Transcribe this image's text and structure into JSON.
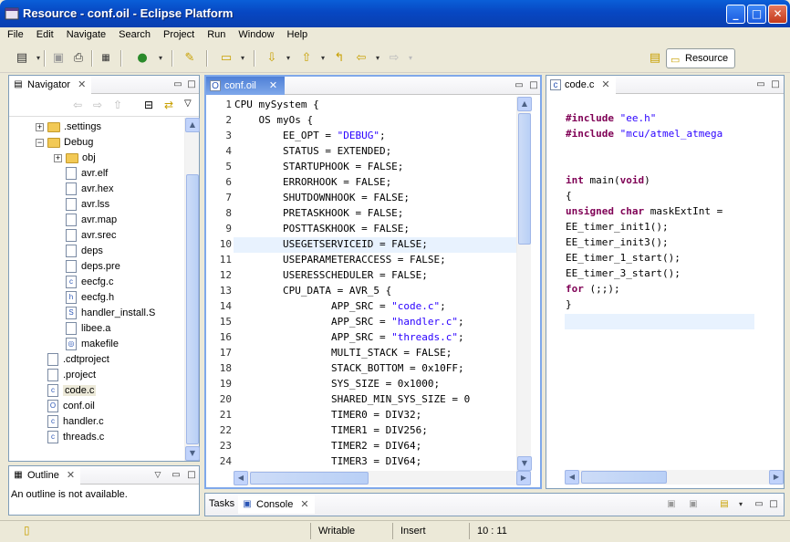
{
  "window": {
    "title": "Resource - conf.oil - Eclipse Platform",
    "min": "_",
    "max": "□",
    "close": "✕"
  },
  "menu": [
    "File",
    "Edit",
    "Navigate",
    "Search",
    "Project",
    "Run",
    "Window",
    "Help"
  ],
  "perspective": {
    "label": "Resource"
  },
  "navigator": {
    "title": "Navigator",
    "tree": [
      {
        "label": ".settings",
        "type": "folder",
        "depth": 1,
        "expander": "+"
      },
      {
        "label": "Debug",
        "type": "folder",
        "depth": 1,
        "expander": "−"
      },
      {
        "label": "obj",
        "type": "folder",
        "depth": 2,
        "expander": "+"
      },
      {
        "label": "avr.elf",
        "type": "file",
        "depth": 2
      },
      {
        "label": "avr.hex",
        "type": "file",
        "depth": 2
      },
      {
        "label": "avr.lss",
        "type": "file",
        "depth": 2
      },
      {
        "label": "avr.map",
        "type": "file",
        "depth": 2
      },
      {
        "label": "avr.srec",
        "type": "file",
        "depth": 2
      },
      {
        "label": "deps",
        "type": "file",
        "depth": 2
      },
      {
        "label": "deps.pre",
        "type": "file",
        "depth": 2
      },
      {
        "label": "eecfg.c",
        "type": "c",
        "depth": 2
      },
      {
        "label": "eecfg.h",
        "type": "h",
        "depth": 2
      },
      {
        "label": "handler_install.S",
        "type": "s",
        "depth": 2
      },
      {
        "label": "libee.a",
        "type": "file",
        "depth": 2
      },
      {
        "label": "makefile",
        "type": "make",
        "depth": 2
      },
      {
        "label": ".cdtproject",
        "type": "file",
        "depth": 1
      },
      {
        "label": ".project",
        "type": "file",
        "depth": 1
      },
      {
        "label": "code.c",
        "type": "c",
        "depth": 1,
        "selected": true
      },
      {
        "label": "conf.oil",
        "type": "oil",
        "depth": 1
      },
      {
        "label": "handler.c",
        "type": "c",
        "depth": 1
      },
      {
        "label": "threads.c",
        "type": "c",
        "depth": 1
      }
    ]
  },
  "outline": {
    "title": "Outline",
    "message": "An outline is not available."
  },
  "editor_oil": {
    "tab": "conf.oil",
    "lines": [
      [
        "CPU mySystem {"
      ],
      [
        "    OS myOs {"
      ],
      [
        "        EE_OPT = ",
        "\"DEBUG\"",
        ";"
      ],
      [
        "        STATUS = EXTENDED;"
      ],
      [
        "        STARTUPHOOK = FALSE;"
      ],
      [
        "        ERRORHOOK = FALSE;"
      ],
      [
        "        SHUTDOWNHOOK = FALSE;"
      ],
      [
        "        PRETASKHOOK = FALSE;"
      ],
      [
        "        POSTTASKHOOK = FALSE;"
      ],
      [
        "        USEGETSERVICEID = FALSE;"
      ],
      [
        "        USEPARAMETERACCESS = FALSE;"
      ],
      [
        "        USERESSCHEDULER = FALSE;"
      ],
      [
        "        CPU_DATA = AVR_5 {"
      ],
      [
        "                APP_SRC = ",
        "\"code.c\"",
        ";"
      ],
      [
        "                APP_SRC = ",
        "\"handler.c\"",
        ";"
      ],
      [
        "                APP_SRC = ",
        "\"threads.c\"",
        ";"
      ],
      [
        "                MULTI_STACK = FALSE;"
      ],
      [
        "                STACK_BOTTOM = 0x10FF;"
      ],
      [
        "                SYS_SIZE = 0x1000;"
      ],
      [
        "                SHARED_MIN_SYS_SIZE = 0"
      ],
      [
        "                TIMER0 = DIV32;"
      ],
      [
        "                TIMER1 = DIV256;"
      ],
      [
        "                TIMER2 = DIV64;"
      ],
      [
        "                TIMER3 = DIV64;"
      ]
    ],
    "line_numbers": [
      "1",
      "2",
      "3",
      "4",
      "5",
      "6",
      "7",
      "8",
      "9",
      "10",
      "11",
      "12",
      "13",
      "14",
      "15",
      "16",
      "17",
      "18",
      "19",
      "20",
      "21",
      "22",
      "23",
      "24"
    ]
  },
  "editor_c": {
    "tab": "code.c",
    "lines": [
      {
        "parts": [
          [
            "pp",
            "#include "
          ],
          [
            "str",
            "\"ee.h\""
          ]
        ]
      },
      {
        "parts": [
          [
            "pp",
            "#include "
          ],
          [
            "str",
            "\"mcu/atmel_atmega"
          ]
        ]
      },
      {
        "parts": []
      },
      {
        "parts": []
      },
      {
        "parts": [
          [
            "kw",
            "int"
          ],
          [
            "t",
            " main("
          ],
          [
            "kw",
            "void"
          ],
          [
            "t",
            ")"
          ]
        ]
      },
      {
        "parts": [
          [
            "t",
            "{"
          ]
        ]
      },
      {
        "parts": [
          [
            "kw",
            "unsigned"
          ],
          [
            "t",
            " "
          ],
          [
            "kw",
            "char"
          ],
          [
            "t",
            " maskExtInt ="
          ]
        ]
      },
      {
        "parts": [
          [
            "t",
            "EE_timer_init1();"
          ]
        ]
      },
      {
        "parts": [
          [
            "t",
            "EE_timer_init3();"
          ]
        ]
      },
      {
        "parts": [
          [
            "t",
            "EE_timer_1_start();"
          ]
        ]
      },
      {
        "parts": [
          [
            "t",
            "EE_timer_3_start();"
          ]
        ]
      },
      {
        "parts": [
          [
            "kw",
            "for"
          ],
          [
            "t",
            " (;;);"
          ]
        ]
      },
      {
        "parts": [
          [
            "t",
            "}"
          ]
        ]
      }
    ]
  },
  "bottom": {
    "tabs": [
      "Tasks",
      "Console"
    ]
  },
  "status": {
    "writable": "Writable",
    "insert": "Insert",
    "position": "10 : 11"
  }
}
